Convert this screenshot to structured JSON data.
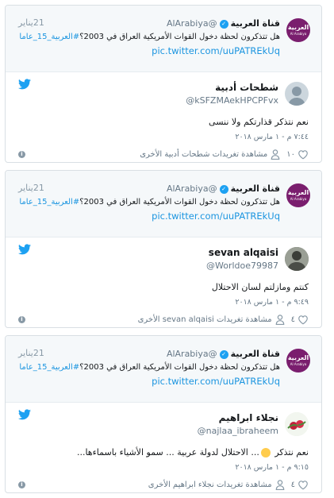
{
  "tweets": [
    {
      "quoted": {
        "name": "قناة العربية",
        "handle": "@AlArabiya",
        "date": "21يناير",
        "text": "هل تتذكرون لحظة دخول القوات الأمريكية العراق في 2003؟",
        "hashtag": "#العربية_15_عاما",
        "link": "pic.twitter.com/uuPATREkUq",
        "avatar_text": "العربية",
        "avatar_sub": "Al Arabiya"
      },
      "reply": {
        "name": "شطحات أدبية",
        "handle": "@kSFZMAekHPCPFvx",
        "text": "نعم نتذكر قذارتكم ولا ننسى",
        "time": "٧:٤٤ م - ١ مارس ٢٠١٨",
        "likes": "١٠",
        "profile_link": "مشاهدة تغريدات شطحات أدبية الأخرى"
      }
    },
    {
      "quoted": {
        "name": "قناة العربية",
        "handle": "@AlArabiya",
        "date": "21يناير",
        "text": "هل تتذكرون لحظة دخول القوات الأمريكية العراق في 2003؟",
        "hashtag": "#العربية_15_عاما",
        "link": "pic.twitter.com/uuPATREkUq",
        "avatar_text": "العربية",
        "avatar_sub": "Al Arabiya"
      },
      "reply": {
        "name": "sevan alqaisi",
        "handle": "@Worldoe79987",
        "text": "كنتم ومازلتم لسان الاحتلال",
        "time": "٩:٤٩ م - ١ مارس ٢٠١٨",
        "likes": "٤",
        "profile_link": "مشاهدة تغريدات sevan alqaisi الأخرى"
      }
    },
    {
      "quoted": {
        "name": "قناة العربية",
        "handle": "@AlArabiya",
        "date": "21يناير",
        "text": "هل تتذكرون لحظة دخول القوات الأمريكية العراق في 2003؟",
        "hashtag": "#العربية_15_عاما",
        "link": "pic.twitter.com/uuPATREkUq",
        "avatar_text": "العربية",
        "avatar_sub": "Al Arabiya"
      },
      "reply": {
        "name": "نجلاء ابراهيم",
        "handle": "@najlaa_ibraheem",
        "text_before": "نعم نتذكر",
        "text_after": "... الاحتلال لدولة عربية ... سمو الأشياء باسماءها...",
        "time": "٩:١٥ م - ١ مارس ٢٠١٨",
        "likes": "٤",
        "profile_link": "مشاهدة تغريدات نجلاء ابراهيم الأخرى"
      }
    }
  ],
  "colors": {
    "accent": "#1da1f2",
    "link": "#1b95e0",
    "brand_avatar": "#7a1e6e"
  }
}
